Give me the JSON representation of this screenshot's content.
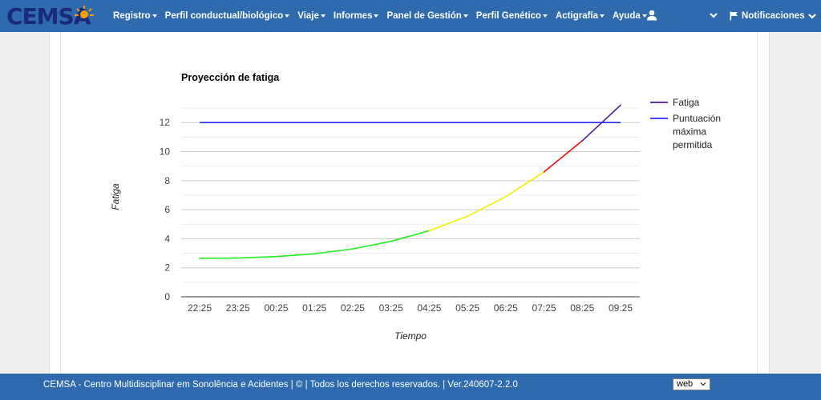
{
  "header": {
    "logo_text": "CEMSA",
    "nav": [
      {
        "label": "Registro"
      },
      {
        "label": "Perfil conductual/biológico"
      },
      {
        "label": "Viaje"
      },
      {
        "label": "Informes"
      },
      {
        "label": "Panel de Gestión"
      },
      {
        "label": "Perfil Genético"
      },
      {
        "label": "Actigrafía"
      },
      {
        "label": "Ayuda"
      }
    ],
    "notifications_label": "Notificaciones"
  },
  "colors": {
    "brand_blue": "#2e6aad",
    "fatigue_purple": "#4b1c9c",
    "max_line_blue": "#2a2aee",
    "green": "#22ee22",
    "yellow": "#f2f200",
    "red": "#ee1111"
  },
  "chart_data": {
    "type": "line",
    "title": "Proyección de fatiga",
    "xlabel": "Tiempo",
    "ylabel": "Fatiga",
    "categories": [
      "22:25",
      "23:25",
      "00:25",
      "01:25",
      "02:25",
      "03:25",
      "04:25",
      "05:25",
      "06:25",
      "07:25",
      "08:25",
      "09:25"
    ],
    "ylim": [
      0,
      13.5
    ],
    "yticks": [
      0,
      2,
      4,
      6,
      8,
      10,
      12
    ],
    "grid": true,
    "legend_position": "right",
    "series": [
      {
        "name": "Fatiga",
        "values": [
          2.65,
          2.67,
          2.77,
          2.96,
          3.3,
          3.82,
          4.55,
          5.55,
          6.9,
          8.6,
          10.75,
          13.2
        ],
        "segment_colors": [
          "green",
          "green",
          "green",
          "green",
          "green",
          "green",
          "yellow",
          "yellow",
          "yellow",
          "red",
          "purple"
        ]
      },
      {
        "name": "Puntuación máxima permitida",
        "values": [
          12,
          12,
          12,
          12,
          12,
          12,
          12,
          12,
          12,
          12,
          12,
          12
        ]
      }
    ],
    "legend": [
      {
        "lines": [
          "Fatiga"
        ]
      },
      {
        "lines": [
          "Puntuación",
          "máxima",
          "permitida"
        ]
      }
    ]
  },
  "footer": {
    "text": "CEMSA - Centro Multidisciplinar em Sonolência e Acidentes | © | Todos los derechos reservados. | Ver.240607-2.2.0",
    "lang_value": "web"
  }
}
